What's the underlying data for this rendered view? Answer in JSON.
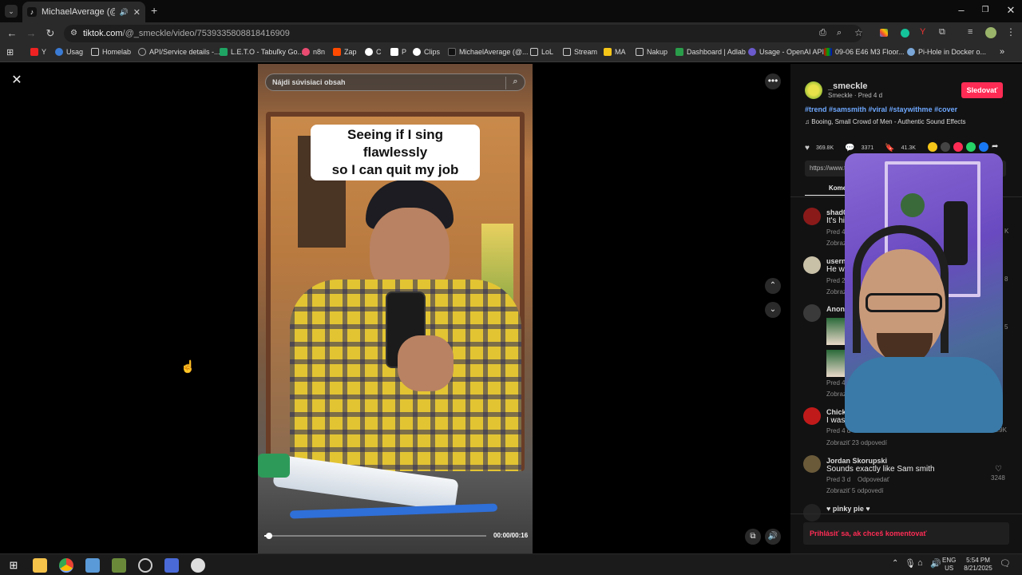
{
  "browser": {
    "tab_title": "MichaelAverage (@proste...",
    "url_host": "tiktok.com",
    "url_path": "/@_smeckle/video/7539335808818416909",
    "bookmarks": [
      "Y",
      "Usag",
      "Homelab",
      "API/Service details -...",
      "L.E.T.O - Tabuľky Go...",
      "n8n",
      "Zap",
      "C",
      "P",
      "Clips",
      "MichaelAverage (@...",
      "LoL",
      "Stream",
      "MA",
      "Nakup",
      "Dashboard | Adlab",
      "Usage - OpenAI API",
      "09-06 E46 M3 Floor...",
      "Pi-Hole in Docker o..."
    ]
  },
  "video": {
    "search_placeholder": "Nájdi súvisiaci obsah",
    "caption_line1": "Seeing if I sing flawlessly",
    "caption_line2": "so I can quit my job",
    "time": "00:00/00:16",
    "progress": 0.02
  },
  "author": {
    "username": "_smeckle",
    "meta": "Smeckle · Pred 4 d",
    "follow_label": "Sledovať",
    "hashtags": "#trend #samsmith #viral #staywithme #cover",
    "sound": "Booing, Small Crowd of Men - Authentic Sound Effects"
  },
  "stats": {
    "likes": "369.8K",
    "comments": "3371",
    "saves": "41.3K",
    "link_prefix": "https://www.t",
    "tab_comments": "Kome"
  },
  "comments": [
    {
      "name": "shad0",
      "text": "It's his",
      "time": "Pred 4",
      "replies": "Zobraz",
      "likes": "K"
    },
    {
      "name": "userna",
      "text": "He wa",
      "time": "Pred 2",
      "replies": "Zobraz",
      "likes": "8"
    },
    {
      "name": "Anony",
      "text": "",
      "time": "Pred 4",
      "replies": "Zobraz",
      "likes": "5"
    },
    {
      "name": "Chicke",
      "text": "I was w",
      "time": "Pred 4 d",
      "replies": "Zobraziť 23 odpovedí",
      "likes": "12.9K"
    },
    {
      "name": "Jordan Skorupski",
      "text": "Sounds exactly like Sam smith",
      "time": "Pred 3 d",
      "reply_label": "Odpovedať",
      "replies": "Zobraziť 5 odpovedí",
      "likes": "3248"
    },
    {
      "name": "♥ pinky pie ♥",
      "text": "",
      "time": "",
      "replies": "",
      "likes": ""
    }
  ],
  "login_prompt": "Prihlásiť sa, ak chceš komentovať",
  "taskbar": {
    "lang": "ENG",
    "region": "US",
    "time": "5:54 PM",
    "date": "8/21/2025"
  },
  "colors": {
    "accent": "#fe2c55",
    "hashtag": "#6ea8ff"
  }
}
